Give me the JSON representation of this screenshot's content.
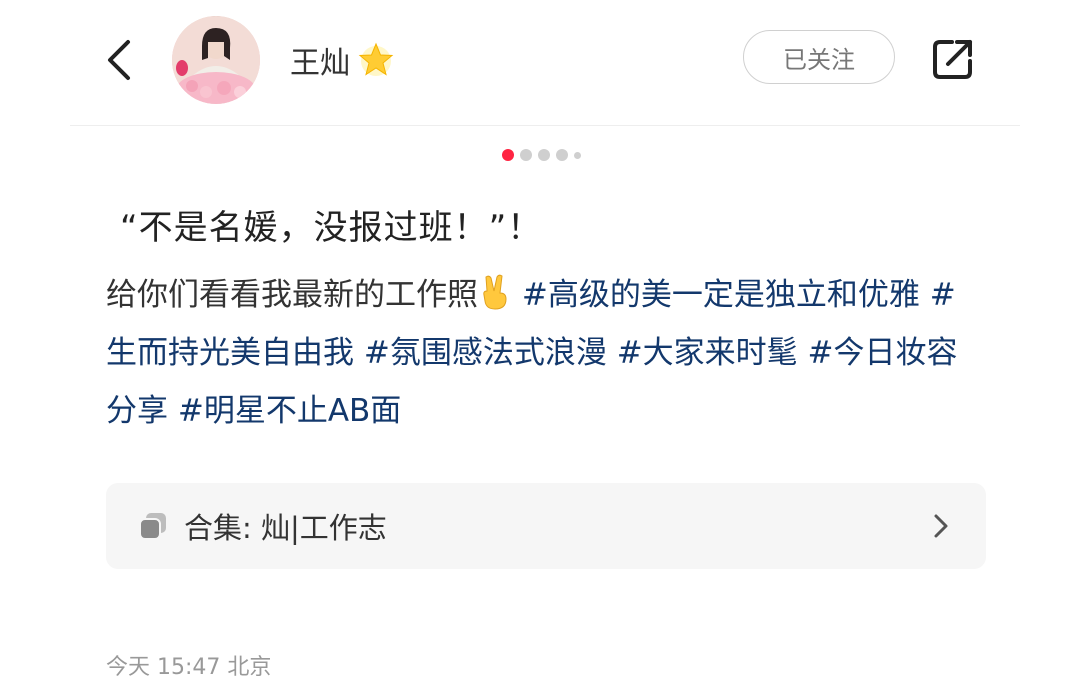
{
  "header": {
    "username": "王灿",
    "follow_label": "已关注"
  },
  "carousel": {
    "total": 5,
    "active": 1
  },
  "post": {
    "title": "“不是名媛，没报过班！”！",
    "body_prefix": "给你们看看我最新的工作照",
    "tags": [
      "#高级的美一定是独立和优雅",
      "#生而持光美自由我",
      "#氛围感法式浪漫",
      "#大家来时髦",
      "#今日妆容分享",
      "#明星不止AB面"
    ]
  },
  "collection": {
    "label": "合集: 灿|工作志"
  },
  "meta": {
    "time_location": "今天 15:47 北京"
  },
  "colors": {
    "accent": "#ff2442",
    "tag": "#13386c"
  }
}
